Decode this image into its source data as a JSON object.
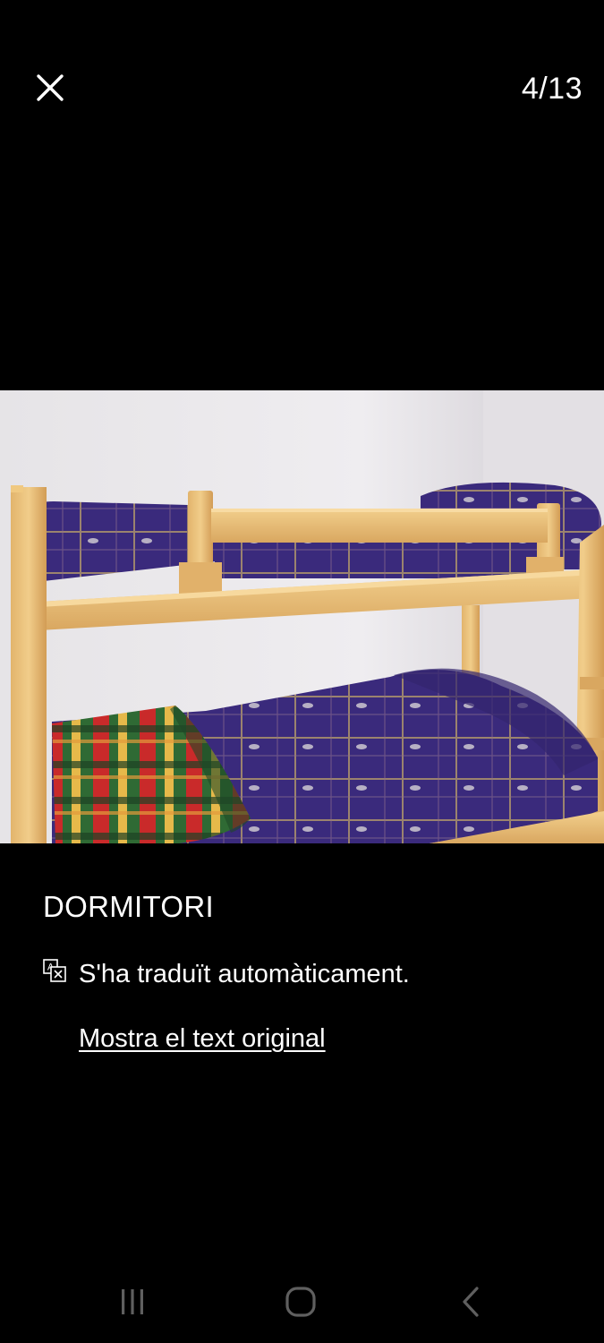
{
  "viewer": {
    "counter": "4/13",
    "close_icon": "close-icon"
  },
  "photo": {
    "subject": "bunk-bed-photo"
  },
  "caption": {
    "title": "DORMITORI",
    "translated_notice": "S'ha traduït automàticament.",
    "show_original_label": "Mostra el text original",
    "translate_icon": "translate-icon"
  },
  "system_nav": {
    "recents_icon": "recent-apps-icon",
    "home_icon": "home-icon",
    "back_icon": "back-icon"
  },
  "colors": {
    "background": "#000000",
    "text": "#ffffff",
    "nav_icons": "#5f5f5f"
  }
}
